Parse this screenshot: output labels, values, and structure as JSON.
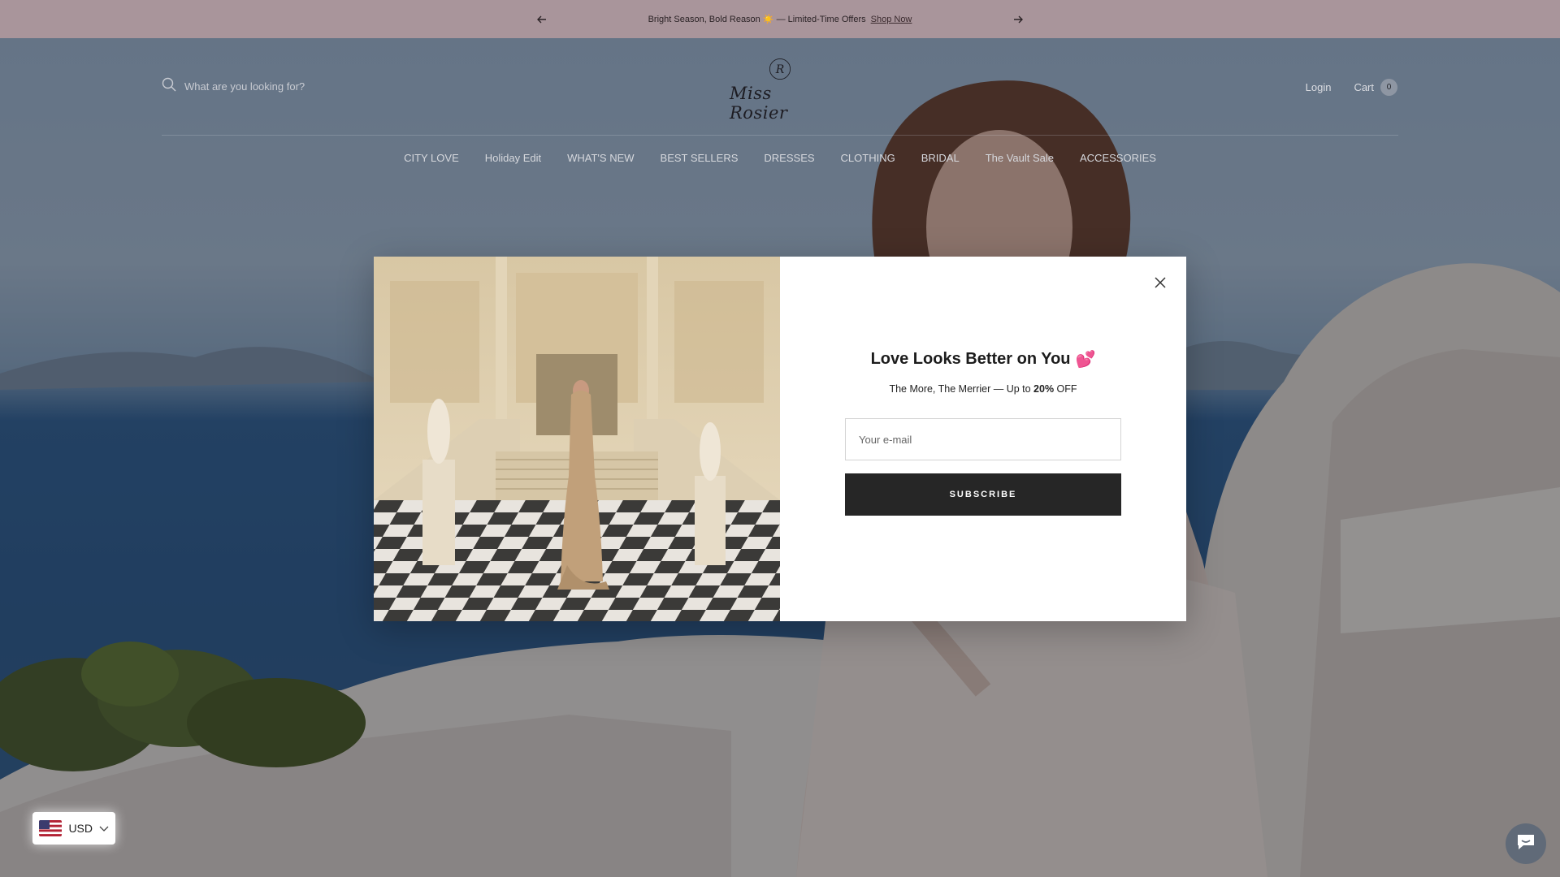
{
  "announcement": {
    "message": "Bright Season, Bold Reason ☀️ — Limited-Time Offers",
    "link": "Shop Now",
    "prev_icon": "arrow-left-icon",
    "next_icon": "arrow-right-icon"
  },
  "header": {
    "search_placeholder": "What are you looking for?",
    "search_icon": "search-icon",
    "logo_monogram": "R",
    "logo_text": "Miss Rosier",
    "login": "Login",
    "cart_label": "Cart",
    "cart_count": "0"
  },
  "nav": {
    "items": [
      "CITY LOVE",
      "Holiday Edit",
      "WHAT'S NEW",
      "BEST SELLERS",
      "DRESSES",
      "CLOTHING",
      "BRIDAL",
      "The Vault Sale",
      "ACCESSORIES"
    ]
  },
  "modal": {
    "title": "Love Looks Better on You",
    "title_emoji": "💕",
    "subtitle_prefix": "The More, The Merrier — Up to ",
    "subtitle_bold": "20%",
    "subtitle_suffix": " OFF",
    "email_placeholder": "Your e-mail",
    "subscribe_label": "SUBSCRIBE",
    "close_icon": "close-icon"
  },
  "currency": {
    "code": "USD",
    "flag": "us-flag-icon"
  },
  "chat": {
    "icon": "chat-icon"
  },
  "colors": {
    "announce_bg": "#a9959b",
    "button_bg": "#262626",
    "overlay": "rgba(20,24,34,0.42)"
  }
}
